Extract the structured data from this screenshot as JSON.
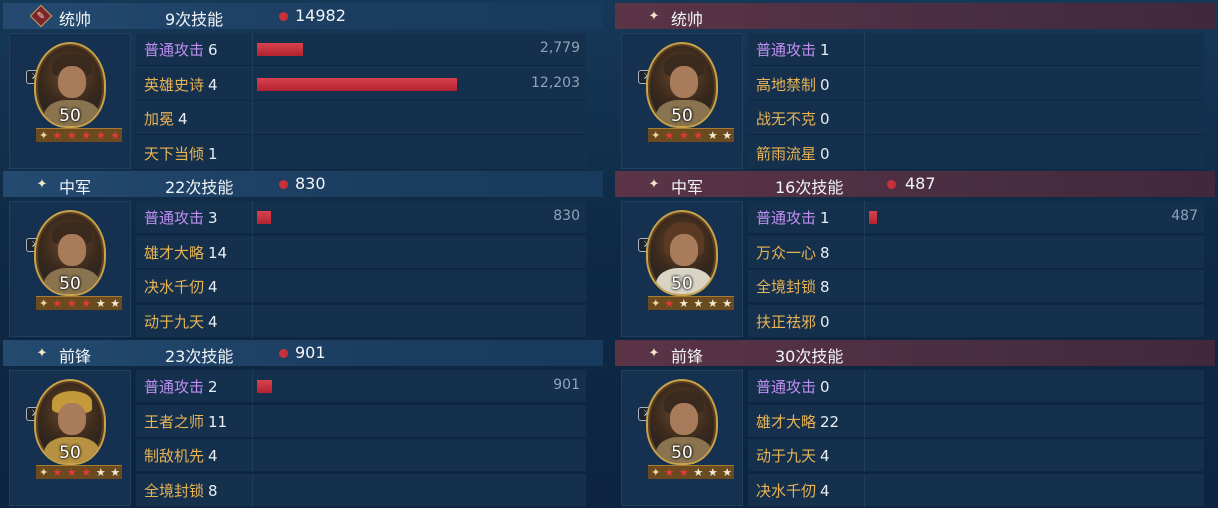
{
  "left": {
    "groups": [
      {
        "role": "统帅",
        "casts": "9次技能",
        "damage": "14982",
        "role_icon": "commander-badge-icon",
        "general": {
          "level": "50",
          "stars": 5,
          "red_stars": 5,
          "portrait": "bearded-general-portrait"
        },
        "skills": [
          {
            "name": "普通攻击",
            "count": "6",
            "style": "purple",
            "bar": 0.2277,
            "value": "2,779"
          },
          {
            "name": "英雄史诗",
            "count": "4",
            "style": "gold",
            "bar": 1.0,
            "value": "12,203"
          },
          {
            "name": "加冕",
            "count": "4",
            "style": "gold",
            "bar": 0,
            "value": ""
          },
          {
            "name": "天下当倾",
            "count": "1",
            "style": "gold",
            "bar": 0,
            "value": ""
          }
        ]
      },
      {
        "role": "中军",
        "casts": "22次技能",
        "damage": "830",
        "role_icon": "sparkle-icon",
        "general": {
          "level": "50",
          "stars": 5,
          "red_stars": 3,
          "portrait": "young-general-portrait"
        },
        "skills": [
          {
            "name": "普通攻击",
            "count": "3",
            "style": "purple",
            "bar": 0.068,
            "value": "830"
          },
          {
            "name": "雄才大略",
            "count": "14",
            "style": "gold",
            "bar": 0,
            "value": ""
          },
          {
            "name": "决水千仞",
            "count": "4",
            "style": "gold",
            "bar": 0,
            "value": ""
          },
          {
            "name": "动于九天",
            "count": "4",
            "style": "gold",
            "bar": 0,
            "value": ""
          }
        ]
      },
      {
        "role": "前锋",
        "casts": "23次技能",
        "damage": "901",
        "role_icon": "sparkle-icon",
        "general": {
          "level": "50",
          "stars": 5,
          "red_stars": 3,
          "portrait": "golden-helmet-general-portrait"
        },
        "skills": [
          {
            "name": "普通攻击",
            "count": "2",
            "style": "purple",
            "bar": 0.074,
            "value": "901"
          },
          {
            "name": "王者之师",
            "count": "11",
            "style": "gold",
            "bar": 0,
            "value": ""
          },
          {
            "name": "制敌机先",
            "count": "4",
            "style": "gold",
            "bar": 0,
            "value": ""
          },
          {
            "name": "全境封锁",
            "count": "8",
            "style": "gold",
            "bar": 0,
            "value": ""
          }
        ]
      }
    ]
  },
  "right": {
    "groups": [
      {
        "role": "统帅",
        "casts": "",
        "damage": "",
        "role_icon": "sparkle-icon",
        "general": {
          "level": "50",
          "stars": 5,
          "red_stars": 3,
          "portrait": "bearded-warrior-portrait"
        },
        "skills": [
          {
            "name": "普通攻击",
            "count": "1",
            "style": "purple",
            "bar": 0,
            "value": ""
          },
          {
            "name": "高地禁制",
            "count": "0",
            "style": "gold",
            "bar": 0,
            "value": ""
          },
          {
            "name": "战无不克",
            "count": "0",
            "style": "gold",
            "bar": 0,
            "value": ""
          },
          {
            "name": "箭雨流星",
            "count": "0",
            "style": "gold",
            "bar": 0,
            "value": ""
          }
        ]
      },
      {
        "role": "中军",
        "casts": "16次技能",
        "damage": "487",
        "role_icon": "sparkle-icon",
        "general": {
          "level": "50",
          "stars": 5,
          "red_stars": 1,
          "portrait": "female-knight-portrait"
        },
        "skills": [
          {
            "name": "普通攻击",
            "count": "1",
            "style": "purple",
            "bar": 0.04,
            "value": "487"
          },
          {
            "name": "万众一心",
            "count": "8",
            "style": "gold",
            "bar": 0,
            "value": ""
          },
          {
            "name": "全境封锁",
            "count": "8",
            "style": "gold",
            "bar": 0,
            "value": ""
          },
          {
            "name": "扶正祛邪",
            "count": "0",
            "style": "gold",
            "bar": 0,
            "value": ""
          }
        ]
      },
      {
        "role": "前锋",
        "casts": "30次技能",
        "damage": "",
        "role_icon": "sparkle-icon",
        "general": {
          "level": "50",
          "stars": 5,
          "red_stars": 2,
          "portrait": "young-general-portrait"
        },
        "skills": [
          {
            "name": "普通攻击",
            "count": "0",
            "style": "purple",
            "bar": 0,
            "value": ""
          },
          {
            "name": "雄才大略",
            "count": "22",
            "style": "gold",
            "bar": 0,
            "value": ""
          },
          {
            "name": "动于九天",
            "count": "4",
            "style": "gold",
            "bar": 0,
            "value": ""
          },
          {
            "name": "决水千仞",
            "count": "4",
            "style": "gold",
            "bar": 0,
            "value": ""
          }
        ]
      }
    ]
  },
  "colors": {
    "left_header": "#244a70",
    "right_header": "#5b3446",
    "bar": "#c8303a",
    "skill_purple": "#c08ef0",
    "skill_gold": "#e8b352"
  }
}
